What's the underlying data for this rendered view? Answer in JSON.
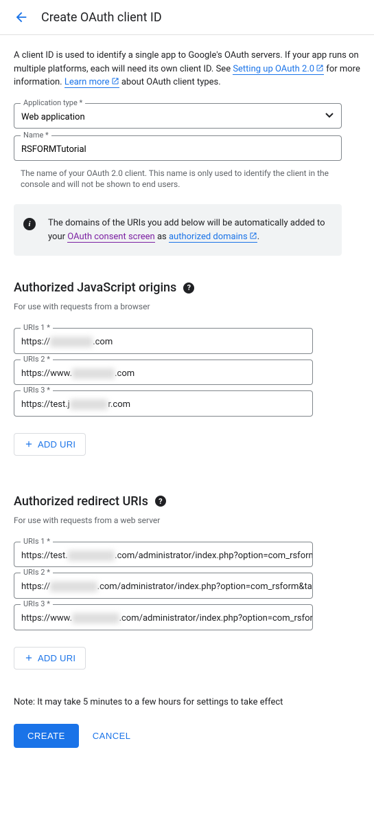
{
  "header": {
    "title": "Create OAuth client ID"
  },
  "intro": {
    "part1": "A client ID is used to identify a single app to Google's OAuth servers. If your app runs on multiple platforms, each will need its own client ID. See ",
    "link1": "Setting up OAuth 2.0",
    "part2": " for more information. ",
    "link2": "Learn more",
    "part3": " about OAuth client types."
  },
  "appType": {
    "label": "Application type *",
    "value": "Web application"
  },
  "name": {
    "label": "Name *",
    "value": "RSFORMTutorial"
  },
  "nameHelper": "The name of your OAuth 2.0 client. This name is only used to identify the client in the console and will not be shown to end users.",
  "infoBox": {
    "part1": "The domains of the URIs you add below will be automatically added to your ",
    "link1": "OAuth consent screen",
    "part2": " as ",
    "link2": "authorized domains",
    "part3": "."
  },
  "jsOrigins": {
    "title": "Authorized JavaScript origins",
    "sub": "For use with requests from a browser",
    "items": [
      {
        "label": "URIs 1 *",
        "pre": "https://",
        "blur": "xxxxxxxxx",
        "post": ".com"
      },
      {
        "label": "URIs 2 *",
        "pre": "https://www.",
        "blur": "xxxxxxxxx",
        "post": ".com"
      },
      {
        "label": "URIs 3 *",
        "pre": "https://test.j",
        "blur": "xxxxxxxx",
        "post": "r.com"
      }
    ],
    "addLabel": "ADD URI"
  },
  "redirectUris": {
    "title": "Authorized redirect URIs",
    "sub": "For use with requests from a web server",
    "items": [
      {
        "label": "URIs 1 *",
        "pre": "https://test.",
        "blur": "xxxxxxxxxx",
        "post": ".com/administrator/index.php?option=com_rsform&"
      },
      {
        "label": "URIs 2 *",
        "pre": "https://",
        "blur": "xxxxxxxxxx",
        "post": ".com/administrator/index.php?option=com_rsform&tas"
      },
      {
        "label": "URIs 3 *",
        "pre": "https://www.",
        "blur": "xxxxxxxxxx",
        "post": ".com/administrator/index.php?option=com_rsform"
      }
    ],
    "addLabel": "ADD URI"
  },
  "note": "Note: It may take 5 minutes to a few hours for settings to take effect",
  "actions": {
    "create": "CREATE",
    "cancel": "CANCEL"
  }
}
